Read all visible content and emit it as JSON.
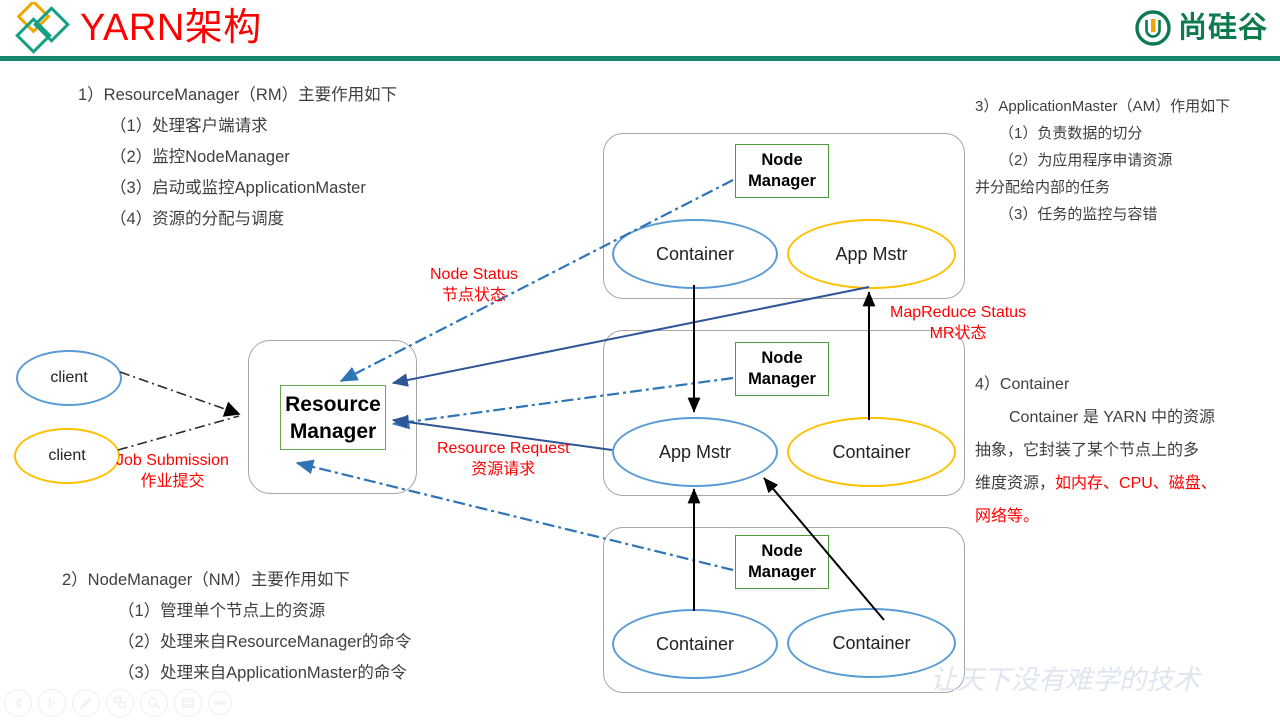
{
  "header": {
    "title": "YARN架构",
    "brand": "尚硅谷",
    "logo_left_icon": "diamonds-logo-icon",
    "logo_right_icon": "u-circle-icon"
  },
  "blocks": {
    "resourcemanager": {
      "heading": "1）ResourceManager（RM）主要作用如下",
      "items": [
        "（1）处理客户端请求",
        "（2）监控NodeManager",
        "（3）启动或监控ApplicationMaster",
        "（4）资源的分配与调度"
      ]
    },
    "nodemanager": {
      "heading": "2）NodeManager（NM）主要作用如下",
      "items": [
        "（1）管理单个节点上的资源",
        "（2）处理来自ResourceManager的命令",
        "（3）处理来自ApplicationMaster的命令"
      ]
    },
    "applicationmaster": {
      "heading": "3）ApplicationMaster（AM）作用如下",
      "item1": "（1）负责数据的切分",
      "item2": "（2）为应用程序申请资源",
      "item2_cont": "并分配给内部的任务",
      "item3": "（3）任务的监控与容错"
    },
    "container": {
      "heading": "4）Container",
      "para_line1": "Container 是 YARN 中的资源",
      "para_line2": "抽象，它封装了某个节点上的多",
      "para_line3_black": "维度资源，",
      "para_line3_red": "如内存、CPU、磁盘、",
      "para_line4_red": "网络等。"
    }
  },
  "diagram": {
    "clients": [
      {
        "label": "client",
        "color": "#5b9bd5"
      },
      {
        "label": "client",
        "color": "#ffc000"
      }
    ],
    "resource_manager": {
      "line1": "Resource",
      "line2": "Manager",
      "border_color": "#6aa84f"
    },
    "node_groups": [
      {
        "node_manager": "Node Manager",
        "nm_line1": "Node",
        "nm_line2": "Manager",
        "left_ellipse": {
          "label": "Container",
          "color": "#5b9bd5"
        },
        "right_ellipse": {
          "label": "App Mstr",
          "color": "#ffc000"
        }
      },
      {
        "node_manager": "Node Manager",
        "nm_line1": "Node",
        "nm_line2": "Manager",
        "left_ellipse": {
          "label": "App Mstr",
          "color": "#5b9bd5"
        },
        "right_ellipse": {
          "label": "Container",
          "color": "#ffc000"
        }
      },
      {
        "node_manager": "Node Manager",
        "nm_line1": "Node",
        "nm_line2": "Manager",
        "left_ellipse": {
          "label": "Container",
          "color": "#5b9bd5"
        },
        "right_ellipse": {
          "label": "Container",
          "color": "#5b9bd5"
        }
      }
    ],
    "arrow_labels": {
      "node_status_en": "Node Status",
      "node_status_zh": "节点状态",
      "resource_request_en": "Resource Request",
      "resource_request_zh": "资源请求",
      "mapreduce_status_en": "MapReduce Status",
      "mapreduce_status_zh": "MR状态",
      "job_submission_en": "Job Submission",
      "job_submission_zh": "作业提交"
    },
    "colors": {
      "dashdot_blue": "#2e75b6",
      "solid_blue": "#2f5597",
      "black": "#000000",
      "green_border": "#6aa84f",
      "gray_group": "#a6a6a6",
      "red_label": "#ff0000",
      "title_red": "#ff0000",
      "brand_green": "#0e7a4f"
    }
  },
  "watermark": "让天下没有难学的技术",
  "toolbar": {
    "items": [
      {
        "name": "previous-slide-button",
        "icon": "triangle-left-icon"
      },
      {
        "name": "next-slide-button",
        "icon": "triangle-right-icon"
      },
      {
        "name": "pen-tool-button",
        "icon": "pen-icon"
      },
      {
        "name": "all-slides-button",
        "icon": "grid-slides-icon"
      },
      {
        "name": "zoom-button",
        "icon": "magnifier-icon"
      },
      {
        "name": "presenter-view-button",
        "icon": "screen-icon"
      },
      {
        "name": "more-options-button",
        "icon": "ellipsis-icon"
      }
    ]
  }
}
